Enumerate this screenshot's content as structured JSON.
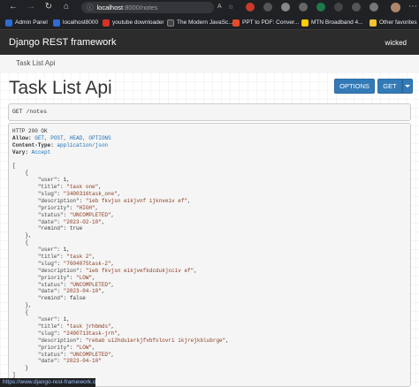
{
  "browser": {
    "url_host": "localhost",
    "url_rest": ":8000/notes",
    "bookmarks": [
      {
        "label": "Admin Panel",
        "color": "#2e6bd6"
      },
      {
        "label": "localhost8000",
        "color": "#2e6bd6"
      },
      {
        "label": "youtube downloader",
        "color": "#d93025"
      },
      {
        "label": "The Modern JavaSc...",
        "color": "#444444"
      },
      {
        "label": "PPT to PDF: Conver...",
        "color": "#e54b2d"
      },
      {
        "label": "MTN Broadband 4...",
        "color": "#ffcc00"
      },
      {
        "label": "Other favorites",
        "color": "#f1c232"
      }
    ],
    "status_url": "https://www.django-rest-framework.org"
  },
  "navbar": {
    "brand": "Django REST framework",
    "user": "wicked"
  },
  "breadcrumb": "Task List Api",
  "page": {
    "title": "Task List Api",
    "options_label": "OPTIONS",
    "get_label": "GET"
  },
  "request": {
    "line": "GET /notes"
  },
  "response": {
    "status": "HTTP 200 OK",
    "headers": [
      {
        "key": "Allow:",
        "value": "GET, POST, HEAD, OPTIONS"
      },
      {
        "key": "Content-Type:",
        "value": "application/json"
      },
      {
        "key": "Vary:",
        "value": "Accept"
      }
    ],
    "tasks": [
      {
        "user": 1,
        "title": "task one",
        "slug": "3400316task_one",
        "description": "ieb fkvjsn eikjvnf ijknveiv ef",
        "priority": "HIGH",
        "status": "UNCOMPLETED",
        "date": "2023-02-10",
        "remind": true
      },
      {
        "user": 1,
        "title": "task 2",
        "slug": "7604075task-2",
        "description": "ieb fkvjsn eikjvefkdcdukjcciv ef",
        "priority": "LOW",
        "status": "UNCOMPLETED",
        "date": "2023-04-10",
        "remind": false
      },
      {
        "user": 1,
        "title": "task jrhbmds",
        "slug": "2490713task-jrh",
        "description": "rebab ui2hduierkjfvbfolovri ikjrejkblubrge",
        "priority": "LOW",
        "status": "UNCOMPLETED",
        "date": "2023-04-10"
      }
    ]
  }
}
